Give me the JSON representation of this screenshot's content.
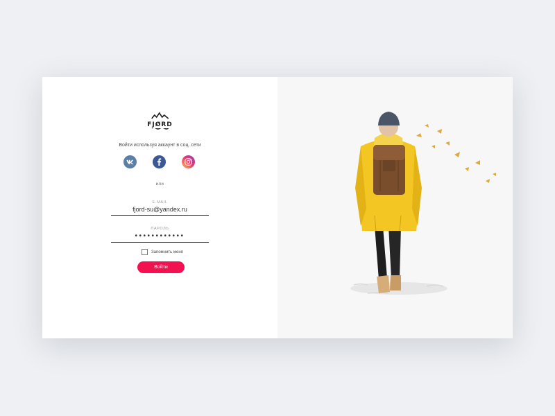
{
  "brand": {
    "name": "FJØRD"
  },
  "social": {
    "caption": "Войти используя аккаунт в соц. сети",
    "buttons": [
      {
        "name": "vk",
        "icon": "vk-icon",
        "color": "#5c7fa7"
      },
      {
        "name": "facebook",
        "icon": "facebook-icon",
        "color": "#3a5894"
      },
      {
        "name": "instagram",
        "icon": "instagram-icon",
        "color": "#ee3b6a"
      }
    ]
  },
  "separator": "или",
  "form": {
    "email": {
      "label": "E-MAIL",
      "value": "fjord-su@yandex.ru"
    },
    "password": {
      "label": "ПАРОЛЬ",
      "value": "••••••••••••"
    },
    "remember_label": "Запомнить меня",
    "submit_label": "Войти"
  },
  "colors": {
    "accent": "#f2124f",
    "jacket": "#f3c623",
    "backpack": "#7a4e2d"
  }
}
